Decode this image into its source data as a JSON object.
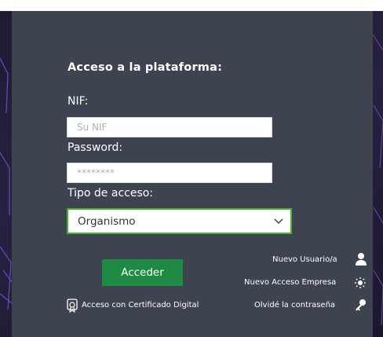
{
  "form": {
    "title": "Acceso a la plataforma:",
    "nif_label": "NIF:",
    "nif_placeholder": "Su NIF",
    "password_label": "Password:",
    "password_placeholder": "********",
    "access_type_label": "Tipo de acceso:",
    "access_type_value": "Organismo",
    "submit_label": "Acceder"
  },
  "links": {
    "certificate": "Acceso con Certificado Digital",
    "new_user": "Nuevo Usuario/a",
    "new_company": "Nuevo Acceso Empresa",
    "forgot_password": "Olvidé la contraseña"
  },
  "colors": {
    "panel": "#3e4350",
    "accent_border": "#4caf2f",
    "button": "#1f8a43"
  },
  "icons": [
    "certificate-icon",
    "user-icon",
    "company-icon",
    "key-icon",
    "chevron-down-icon"
  ]
}
